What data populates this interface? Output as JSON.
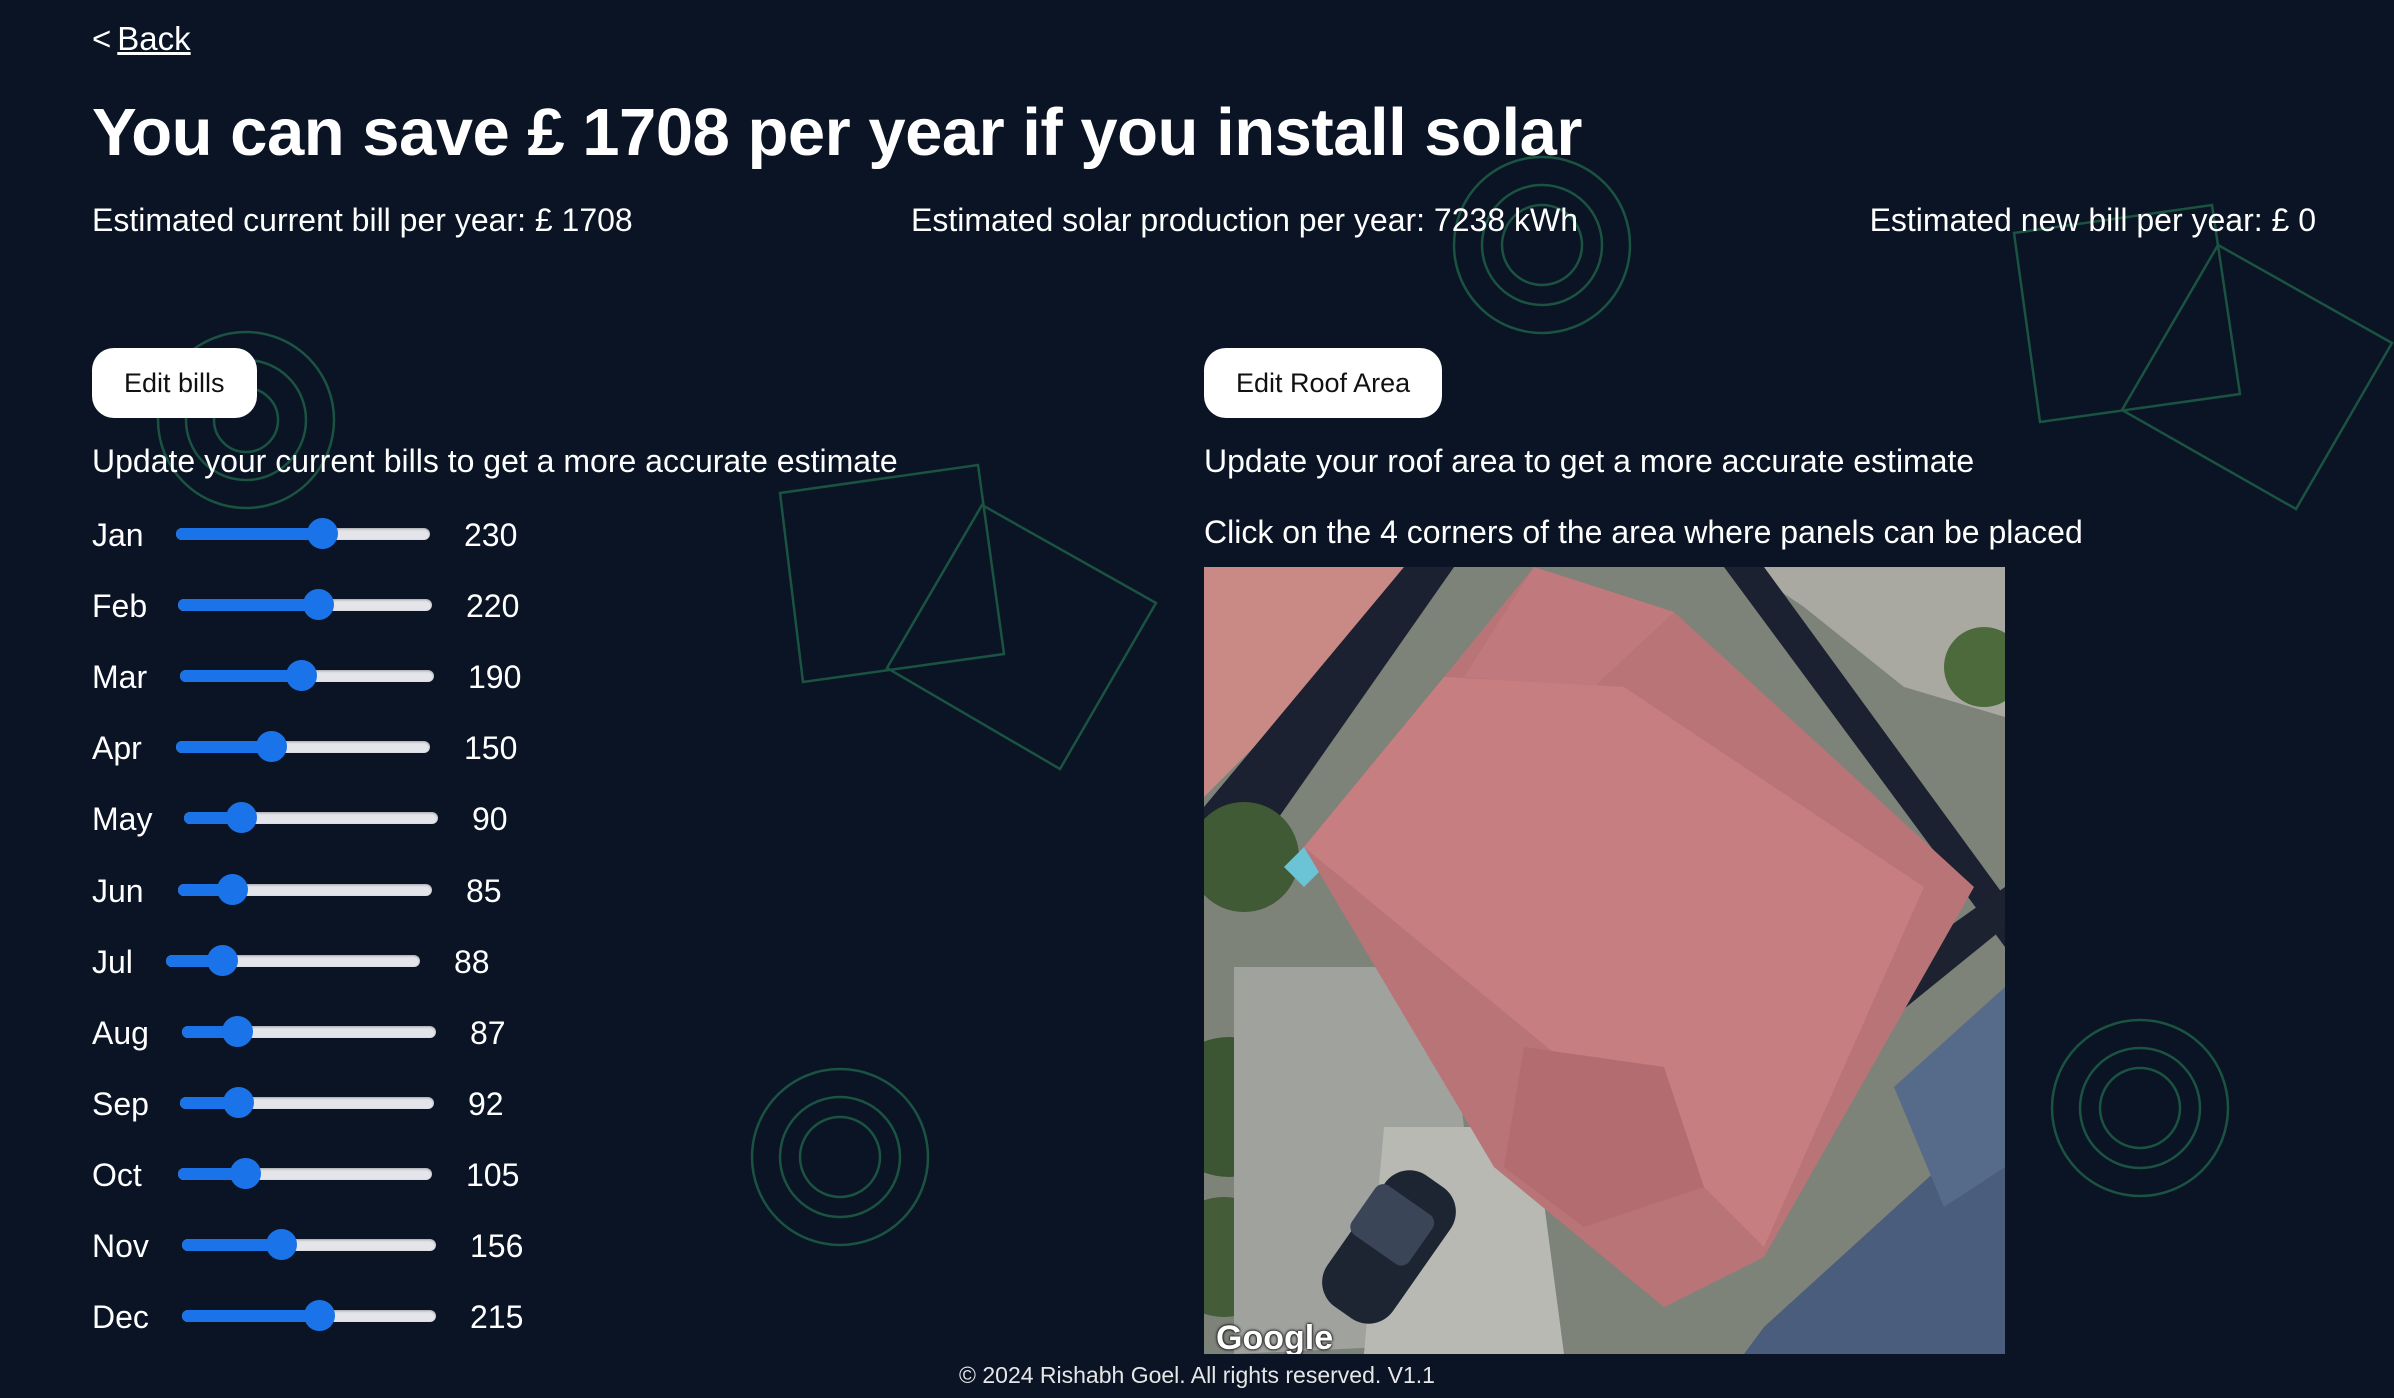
{
  "nav": {
    "back_prefix": "<",
    "back_label": "Back"
  },
  "headline": "You can save £ 1708 per year if you install solar",
  "stats": {
    "current_bill": "Estimated current bill per year: £ 1708",
    "solar_production": "Estimated solar production per year: 7238 kWh",
    "new_bill": "Estimated new bill per year: £ 0"
  },
  "bills_panel": {
    "button_label": "Edit bills",
    "hint": "Update your current bills to get a more accurate estimate",
    "slider_max": 400,
    "months": [
      {
        "label": "Jan",
        "value": 230
      },
      {
        "label": "Feb",
        "value": 220
      },
      {
        "label": "Mar",
        "value": 190
      },
      {
        "label": "Apr",
        "value": 150
      },
      {
        "label": "May",
        "value": 90
      },
      {
        "label": "Jun",
        "value": 85
      },
      {
        "label": "Jul",
        "value": 88
      },
      {
        "label": "Aug",
        "value": 87
      },
      {
        "label": "Sep",
        "value": 92
      },
      {
        "label": "Oct",
        "value": 105
      },
      {
        "label": "Nov",
        "value": 156
      },
      {
        "label": "Dec",
        "value": 215
      }
    ]
  },
  "roof_panel": {
    "button_label": "Edit Roof Area",
    "hint": "Update your roof area to get a more accurate estimate",
    "instruction": "Click on the 4 corners of the area where panels can be placed",
    "map_attribution": "Google"
  },
  "footer": "© 2024 Rishabh Goel. All rights reserved. V1.1",
  "colors": {
    "background": "#0a1425",
    "slider_accent": "#1a73e8",
    "decor": "#1d5a45"
  }
}
